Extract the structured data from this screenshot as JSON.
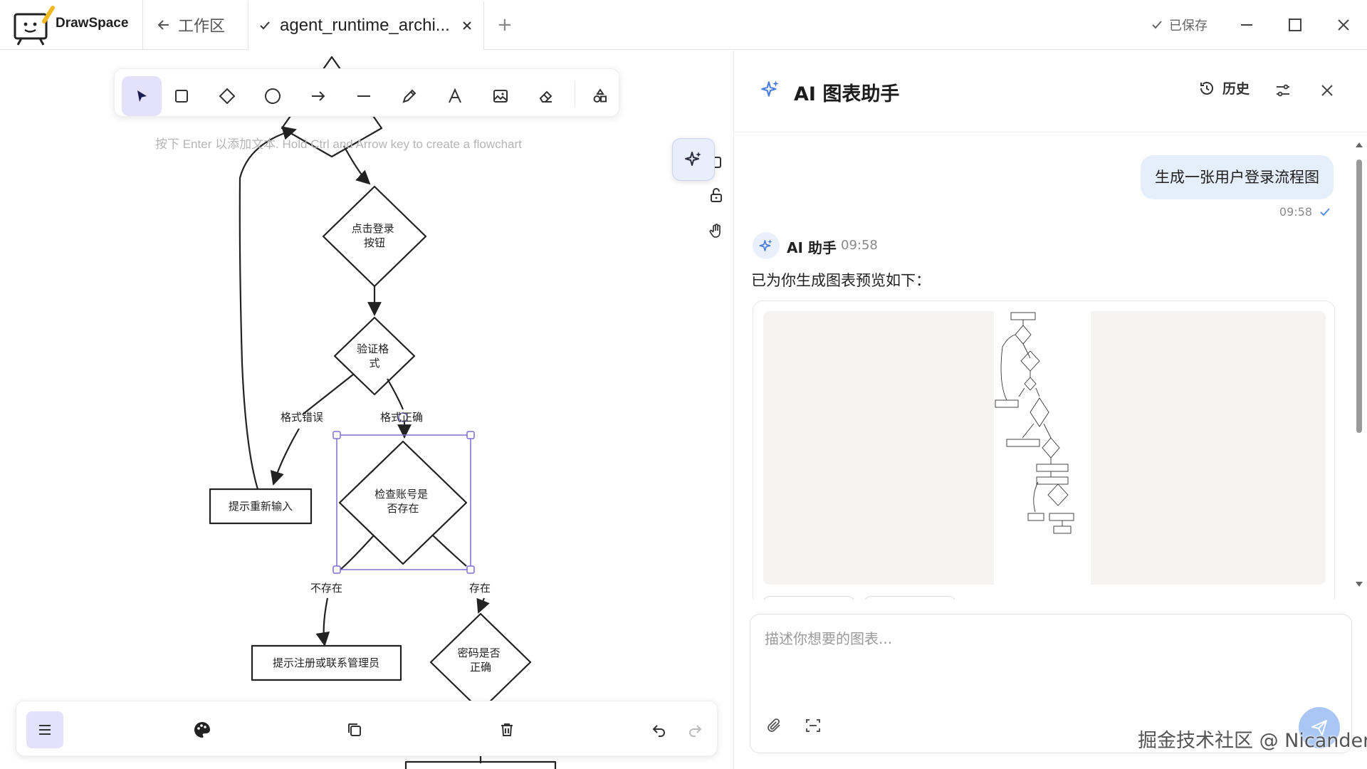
{
  "app": {
    "name": "DrawSpace"
  },
  "tabs": {
    "back_label": "工作区",
    "active_title": "agent_runtime_archi...",
    "add_label": "+"
  },
  "window": {
    "saved_label": "已保存"
  },
  "canvas": {
    "hint": "按下 Enter 以添加文本. Hold Ctrl and Arrow key to create a flowchart",
    "nodes": [
      {
        "id": "click-login",
        "label": "点击登录\n按钮"
      },
      {
        "id": "validate-format",
        "label": "验证格\n式"
      },
      {
        "id": "retry-prompt",
        "label": "提示重新输入"
      },
      {
        "id": "check-account",
        "label": "检查账号是\n否存在"
      },
      {
        "id": "register-prompt",
        "label": "提示注册或联系管理员"
      },
      {
        "id": "password-check",
        "label": "密码是否\n正确"
      }
    ],
    "edge_labels": {
      "format_error": "格式错误",
      "format_ok": "格式正确",
      "not_exists": "不存在",
      "exists": "存在"
    }
  },
  "toolbar": {
    "tools": [
      "select-tool",
      "rectangle-tool",
      "diamond-tool",
      "ellipse-tool",
      "arrow-tool",
      "line-tool",
      "pencil-tool",
      "text-tool",
      "image-tool",
      "eraser-tool",
      "shapes-library-tool"
    ],
    "active": "select-tool"
  },
  "ai_panel": {
    "title": "AI 图表助手",
    "history_label": "历史",
    "messages": {
      "user_text": "生成一张用户登录流程图",
      "user_time": "09:58",
      "ai_name": "AI 助手",
      "ai_time": "09:58",
      "ai_text": "已为你生成图表预览如下："
    },
    "input_placeholder": "描述你想要的图表..."
  },
  "watermark": "掘金技术社区 @ Nicander",
  "colors": {
    "accent": "#6a5acd",
    "active_tool_bg": "#e3e1fb",
    "user_bubble": "#e5eefb",
    "send": "#a9c6f4"
  }
}
